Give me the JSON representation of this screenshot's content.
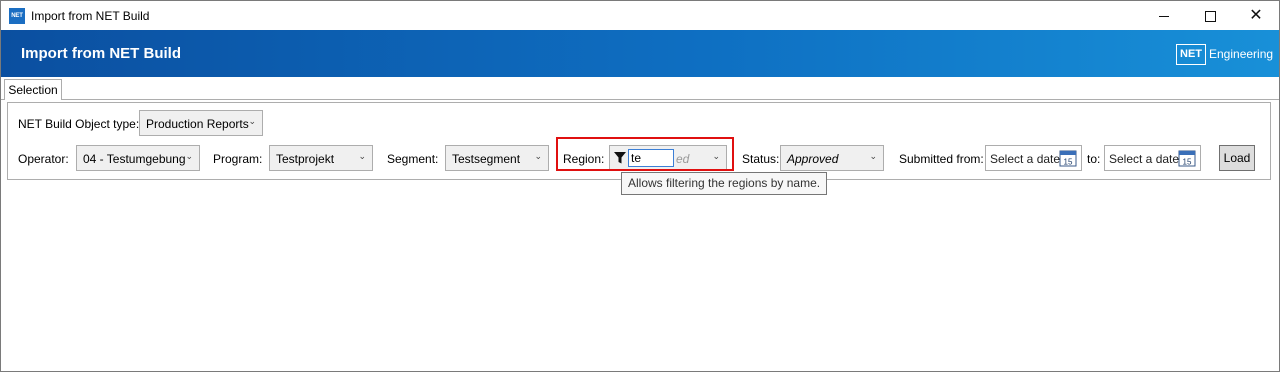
{
  "window": {
    "title": "Import from NET Build",
    "app_icon_text": "NET",
    "controls": {
      "minimize": "minimize",
      "maximize": "maximize",
      "close": "✕"
    }
  },
  "header": {
    "title": "Import from NET Build",
    "logo_box": "NET",
    "logo_text": "Engineering",
    "accent_color": "#0e6fc2"
  },
  "tabs": [
    {
      "label": "Selection",
      "active": true
    }
  ],
  "selection": {
    "object_type": {
      "label": "NET Build Object type:",
      "value": "Production Reports"
    },
    "operator": {
      "label": "Operator:",
      "value": "04 - Testumgebung"
    },
    "program": {
      "label": "Program:",
      "value": "Testprojekt"
    },
    "segment": {
      "label": "Segment:",
      "value": "Testsegment"
    },
    "region": {
      "label": "Region:",
      "filter_value": "te",
      "placeholder_fragment": "ed",
      "tooltip": "Allows filtering the regions by name.",
      "highlight_color": "#e01010"
    },
    "status": {
      "label": "Status:",
      "value": "Approved"
    },
    "submitted_from": {
      "label": "Submitted from:",
      "placeholder": "Select a date",
      "calendar_day": "15"
    },
    "submitted_to": {
      "label": "to:",
      "placeholder": "Select a date",
      "calendar_day": "15"
    },
    "load_button": "Load"
  }
}
